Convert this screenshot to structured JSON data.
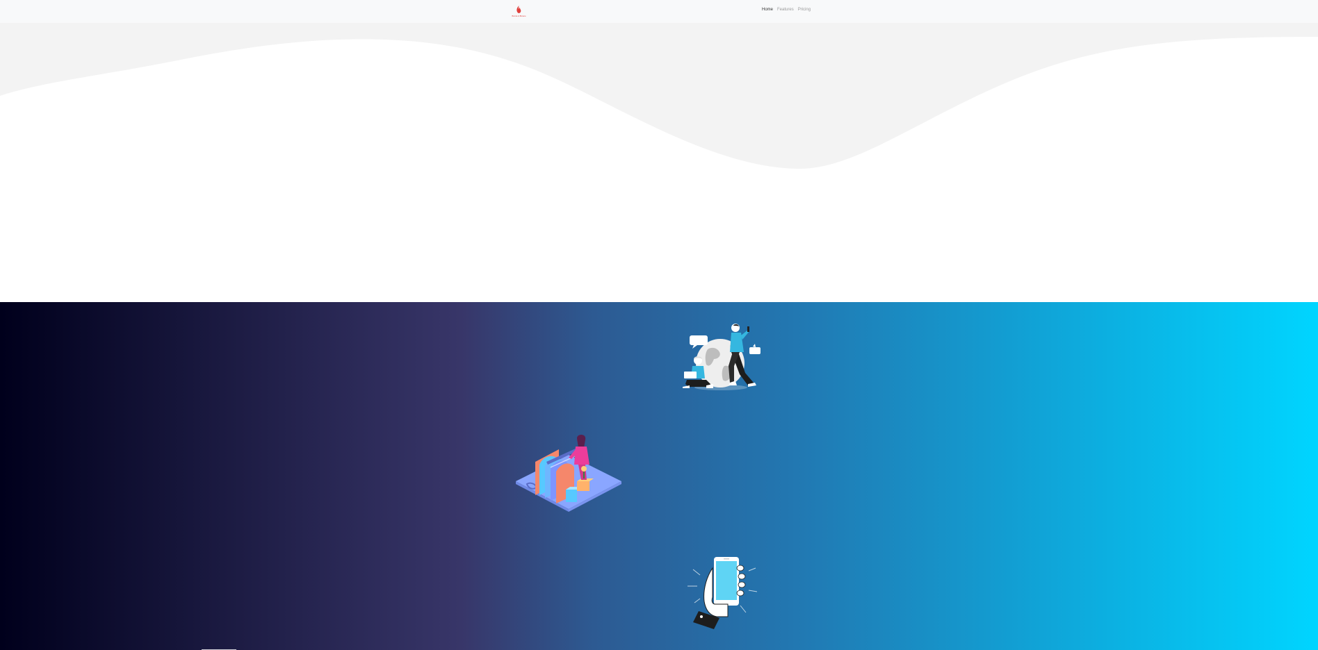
{
  "navbar": {
    "brand_text": "Bonnie & Browne",
    "links": [
      {
        "label": "Home",
        "active": true
      },
      {
        "label": "Features",
        "active": false
      },
      {
        "label": "Pricing",
        "active": false
      }
    ]
  },
  "colors": {
    "brand": "#e0413d",
    "nav_active": "#333333",
    "nav_inactive": "#9a9a9a",
    "hero_wave": "#f3f3f3",
    "gradient_start": "#00001c",
    "gradient_mid": "#383669",
    "gradient_end": "#00d5ff"
  },
  "illustrations": [
    {
      "name": "globe-chat-illustration"
    },
    {
      "name": "file-cabinet-illustration"
    },
    {
      "name": "phone-in-hand-illustration"
    }
  ]
}
